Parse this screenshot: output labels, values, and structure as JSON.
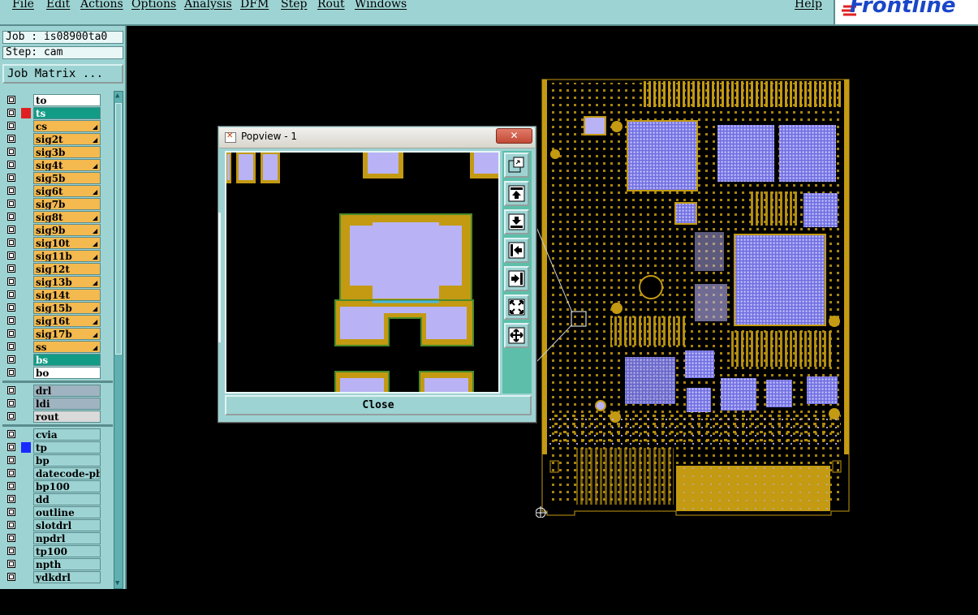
{
  "menu": {
    "items": [
      "File",
      "Edit",
      "Actions",
      "Options",
      "Analysis",
      "DFM",
      "Step",
      "Rout",
      "Windows"
    ],
    "help": "Help"
  },
  "logo": {
    "text": "Frontline"
  },
  "left_panel": {
    "job": "Job : is08900ta0",
    "step": "Step: cam",
    "job_matrix_button": "Job Matrix ..."
  },
  "layers_board": [
    {
      "name": "to",
      "bg": "#ffffff",
      "mark": "",
      "flag": false
    },
    {
      "name": "ts",
      "bg": "#129c86",
      "mark": "#e02020",
      "flag": false
    },
    {
      "name": "cs",
      "bg": "#f4b94f",
      "mark": "",
      "flag": true
    },
    {
      "name": "sig2t",
      "bg": "#f4b94f",
      "mark": "",
      "flag": true
    },
    {
      "name": "sig3b",
      "bg": "#f4b94f",
      "mark": "",
      "flag": false
    },
    {
      "name": "sig4t",
      "bg": "#f4b94f",
      "mark": "",
      "flag": true
    },
    {
      "name": "sig5b",
      "bg": "#f4b94f",
      "mark": "",
      "flag": false
    },
    {
      "name": "sig6t",
      "bg": "#f4b94f",
      "mark": "",
      "flag": true
    },
    {
      "name": "sig7b",
      "bg": "#f4b94f",
      "mark": "",
      "flag": false
    },
    {
      "name": "sig8t",
      "bg": "#f4b94f",
      "mark": "",
      "flag": true
    },
    {
      "name": "sig9b",
      "bg": "#f4b94f",
      "mark": "",
      "flag": true
    },
    {
      "name": "sig10t",
      "bg": "#f4b94f",
      "mark": "",
      "flag": true
    },
    {
      "name": "sig11b",
      "bg": "#f4b94f",
      "mark": "",
      "flag": true
    },
    {
      "name": "sig12t",
      "bg": "#f4b94f",
      "mark": "",
      "flag": false
    },
    {
      "name": "sig13b",
      "bg": "#f4b94f",
      "mark": "",
      "flag": true
    },
    {
      "name": "sig14t",
      "bg": "#f4b94f",
      "mark": "",
      "flag": false
    },
    {
      "name": "sig15b",
      "bg": "#f4b94f",
      "mark": "",
      "flag": true
    },
    {
      "name": "sig16t",
      "bg": "#f4b94f",
      "mark": "",
      "flag": true
    },
    {
      "name": "sig17b",
      "bg": "#f4b94f",
      "mark": "",
      "flag": true
    },
    {
      "name": "ss",
      "bg": "#f4b94f",
      "mark": "",
      "flag": true
    },
    {
      "name": "bs",
      "bg": "#129c86",
      "mark": "",
      "flag": false
    },
    {
      "name": "bo",
      "bg": "#ffffff",
      "mark": "",
      "flag": false
    }
  ],
  "layers_drill": [
    {
      "name": "drl",
      "bg": "#9fb3c0",
      "mark": "",
      "flag": false
    },
    {
      "name": "ldi",
      "bg": "#9fb3c0",
      "mark": "",
      "flag": false
    },
    {
      "name": "rout",
      "bg": "#dadada",
      "mark": "",
      "flag": false
    }
  ],
  "layers_misc": [
    {
      "name": "cvia",
      "bg": "#9ed3d3",
      "mark": "",
      "flag": false
    },
    {
      "name": "tp",
      "bg": "#9ed3d3",
      "mark": "#1a2aff",
      "flag": false
    },
    {
      "name": "bp",
      "bg": "#9ed3d3",
      "mark": "",
      "flag": false
    },
    {
      "name": "datecode-pbe",
      "bg": "#9ed3d3",
      "mark": "",
      "flag": false
    },
    {
      "name": "bp100",
      "bg": "#9ed3d3",
      "mark": "",
      "flag": false
    },
    {
      "name": "dd",
      "bg": "#9ed3d3",
      "mark": "",
      "flag": false
    },
    {
      "name": "outline",
      "bg": "#9ed3d3",
      "mark": "",
      "flag": false
    },
    {
      "name": "slotdrl",
      "bg": "#9ed3d3",
      "mark": "",
      "flag": false
    },
    {
      "name": "npdrl",
      "bg": "#9ed3d3",
      "mark": "",
      "flag": false
    },
    {
      "name": "tp100",
      "bg": "#9ed3d3",
      "mark": "",
      "flag": false
    },
    {
      "name": "npth",
      "bg": "#9ed3d3",
      "mark": "",
      "flag": false
    },
    {
      "name": "ydkdrl",
      "bg": "#9ed3d3",
      "mark": "",
      "flag": false
    }
  ],
  "popview": {
    "title": "Popview - 1",
    "close_x": "✕",
    "close_button": "Close",
    "tools": [
      "zoom-home-icon",
      "pan-up-icon",
      "pan-down-icon",
      "pan-left-icon",
      "pan-right-icon",
      "zoom-out-icon",
      "zoom-in-icon"
    ]
  },
  "colors": {
    "panel": "#9ed3d3",
    "copper": "#c39a12",
    "pad": "#b9b3f5",
    "mask_edge": "#4a8a2a",
    "background": "#000000"
  }
}
